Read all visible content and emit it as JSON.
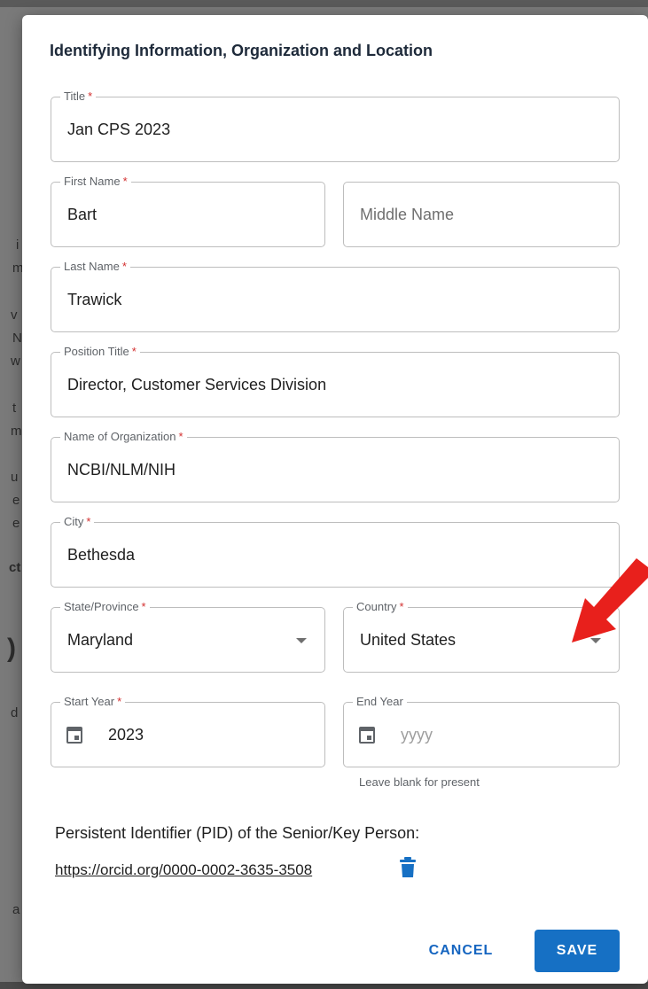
{
  "background_fragments": [
    "i",
    "m",
    "v",
    "N",
    "w",
    "t",
    "m",
    "u",
    "e",
    "e",
    "ct",
    ")",
    "d",
    "a"
  ],
  "dialog": {
    "title": "Identifying Information, Organization and Location"
  },
  "required_marker": "*",
  "fields": {
    "title": {
      "label": "Title",
      "value": "Jan CPS 2023"
    },
    "first_name": {
      "label": "First Name",
      "value": "Bart"
    },
    "middle_name": {
      "placeholder": "Middle Name"
    },
    "last_name": {
      "label": "Last Name",
      "value": "Trawick"
    },
    "position_title": {
      "label": "Position Title",
      "value": "Director, Customer Services Division"
    },
    "organization": {
      "label": "Name of Organization",
      "value": "NCBI/NLM/NIH"
    },
    "city": {
      "label": "City",
      "value": "Bethesda"
    },
    "state": {
      "label": "State/Province",
      "value": "Maryland"
    },
    "country": {
      "label": "Country",
      "value": "United States"
    },
    "start_year": {
      "label": "Start Year",
      "value": "2023"
    },
    "end_year": {
      "label": "End Year",
      "placeholder": "yyyy",
      "helper": "Leave blank for present"
    }
  },
  "pid": {
    "label": "Persistent Identifier (PID) of the Senior/Key Person:",
    "link": "https://orcid.org/0000-0002-3635-3508"
  },
  "buttons": {
    "cancel": "CANCEL",
    "save": "SAVE"
  },
  "icons": {
    "calendar": "calendar-icon",
    "dropdown": "chevron-down-icon",
    "delete": "trash-icon",
    "annotation": "red-arrow-icon"
  },
  "colors": {
    "accent": "#1670c4",
    "required": "#d32f2f",
    "annotation_arrow": "#e8201c"
  }
}
